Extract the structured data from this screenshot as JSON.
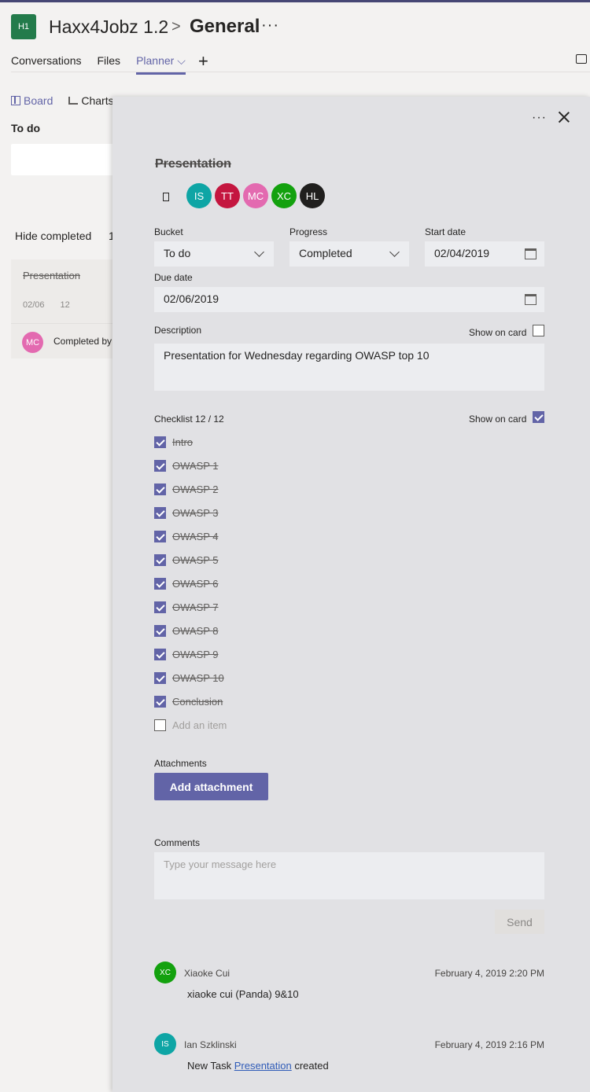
{
  "header": {
    "team_initials": "H1",
    "team_name": "Haxx4Jobz 1.2",
    "separator": ">",
    "channel": "General",
    "more": "···",
    "tabs": [
      "Conversations",
      "Files",
      "Planner ⌵"
    ],
    "add_tab": "+"
  },
  "board": {
    "views": [
      "Board",
      "Charts"
    ],
    "bucket": "To do",
    "hide_completed": "Hide completed",
    "hide_count": "1",
    "card": {
      "title": "Presentation",
      "due": "02/06",
      "checklist": "12",
      "assignee_initials": "MC",
      "completed_by": "Completed by"
    },
    "strip_colors": [
      "#c239b3",
      "#d44a3a",
      "#dd9b3a",
      "#a4c43a",
      "#4f9a8a",
      "#4fb2dc"
    ]
  },
  "panel": {
    "more": "···",
    "title": "Presentation",
    "assignees": [
      {
        "initials": "IS",
        "color": "#0ea5a5"
      },
      {
        "initials": "TT",
        "color": "#c4163f"
      },
      {
        "initials": "MC",
        "color": "#e36ab0"
      },
      {
        "initials": "XC",
        "color": "#13a10e"
      },
      {
        "initials": "HL",
        "color": "#201f1e"
      }
    ],
    "bucket_label": "Bucket",
    "bucket_value": "To do",
    "progress_label": "Progress",
    "progress_value": "Completed",
    "start_label": "Start date",
    "start_value": "02/04/2019",
    "due_label": "Due date",
    "due_value": "02/06/2019",
    "description_label": "Description",
    "show_on_card": "Show on card",
    "description_value": "Presentation for Wednesday regarding OWASP top 10",
    "checklist_label": "Checklist 12 / 12",
    "checklist": [
      "Intro",
      "OWASP 1",
      "OWASP 2",
      "OWASP 3",
      "OWASP 4",
      "OWASP 5",
      "OWASP 6",
      "OWASP 7",
      "OWASP 8",
      "OWASP 9",
      "OWASP 10",
      "Conclusion"
    ],
    "add_item": "Add an item",
    "attachments_label": "Attachments",
    "add_attachment": "Add attachment",
    "comments_label": "Comments",
    "comment_placeholder": "Type your message here",
    "send": "Send",
    "comments": [
      {
        "initials": "XC",
        "color": "#13a10e",
        "author": "Xiaoke Cui",
        "time": "February 4, 2019 2:20 PM",
        "text": "xiaoke cui (Panda) 9&10"
      },
      {
        "initials": "IS",
        "color": "#0ea5a5",
        "author": "Ian Szklinski",
        "time": "February 4, 2019 2:16 PM",
        "text_before": "New Task ",
        "link": "Presentation",
        "text_after": " created"
      }
    ]
  }
}
